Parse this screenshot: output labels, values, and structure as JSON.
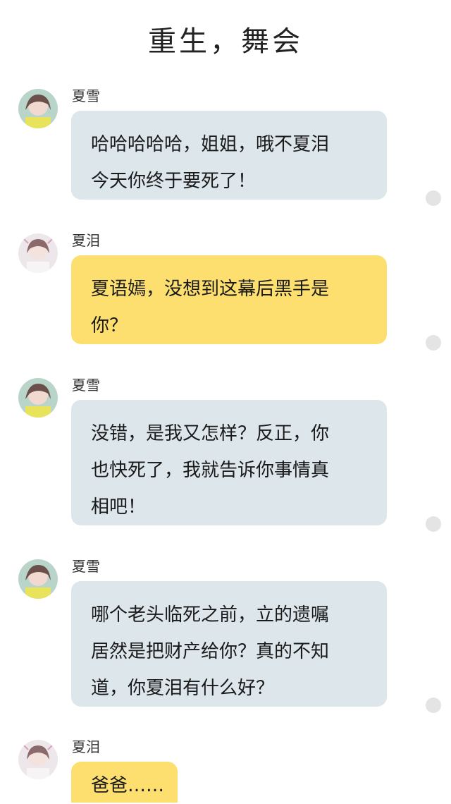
{
  "title": "重生，舞会",
  "messages": [
    {
      "sender": "夏雪",
      "role": "left",
      "bubble_color": "#dce6eb",
      "lines": [
        "哈哈哈哈哈，姐姐，哦不夏泪",
        "今天你终于要死了！"
      ]
    },
    {
      "sender": "夏泪",
      "role": "left",
      "bubble_color": "#fddf6f",
      "lines": [
        "夏语嫣，没想到这幕后黑手是",
        "你？"
      ]
    },
    {
      "sender": "夏雪",
      "role": "left",
      "bubble_color": "#dce6eb",
      "lines": [
        "没错，是我又怎样？反正，你",
        "也快死了，我就告诉你事情真",
        "相吧！"
      ]
    },
    {
      "sender": "夏雪",
      "role": "left",
      "bubble_color": "#dce6eb",
      "lines": [
        "哪个老头临死之前，立的遗嘱",
        "居然是把财产给你？真的不知",
        "道，你夏泪有什么好？"
      ]
    },
    {
      "sender": "夏泪",
      "role": "left",
      "bubble_color": "#fddf6f",
      "lines": [
        "爸爸……"
      ]
    }
  ]
}
